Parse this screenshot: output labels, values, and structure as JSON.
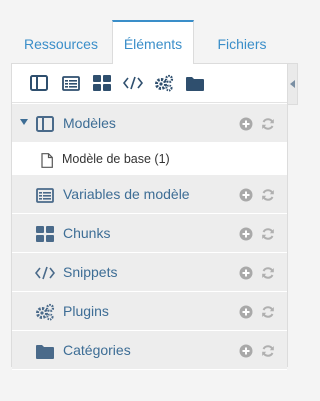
{
  "tabs": [
    {
      "label": "Ressources",
      "active": false
    },
    {
      "label": "Éléments",
      "active": true
    },
    {
      "label": "Fichiers",
      "active": false
    }
  ],
  "toolbar": {
    "icons": [
      "template-icon",
      "list-icon",
      "grid-icon",
      "code-icon",
      "gears-icon",
      "folder-icon"
    ]
  },
  "tree": {
    "templates": {
      "label": "Modèles",
      "expanded": true
    },
    "base_template": {
      "label": "Modèle de base (1)"
    },
    "tvs": {
      "label": "Variables de modèle"
    },
    "chunks": {
      "label": "Chunks"
    },
    "snippets": {
      "label": "Snippets"
    },
    "plugins": {
      "label": "Plugins"
    },
    "categories": {
      "label": "Catégories"
    }
  },
  "colors": {
    "accent": "#3a8ec9",
    "tree_text": "#3d6d95",
    "icon": "#4a6a8a",
    "action_icon": "#b0b0b0",
    "row_bg": "#ededed"
  }
}
